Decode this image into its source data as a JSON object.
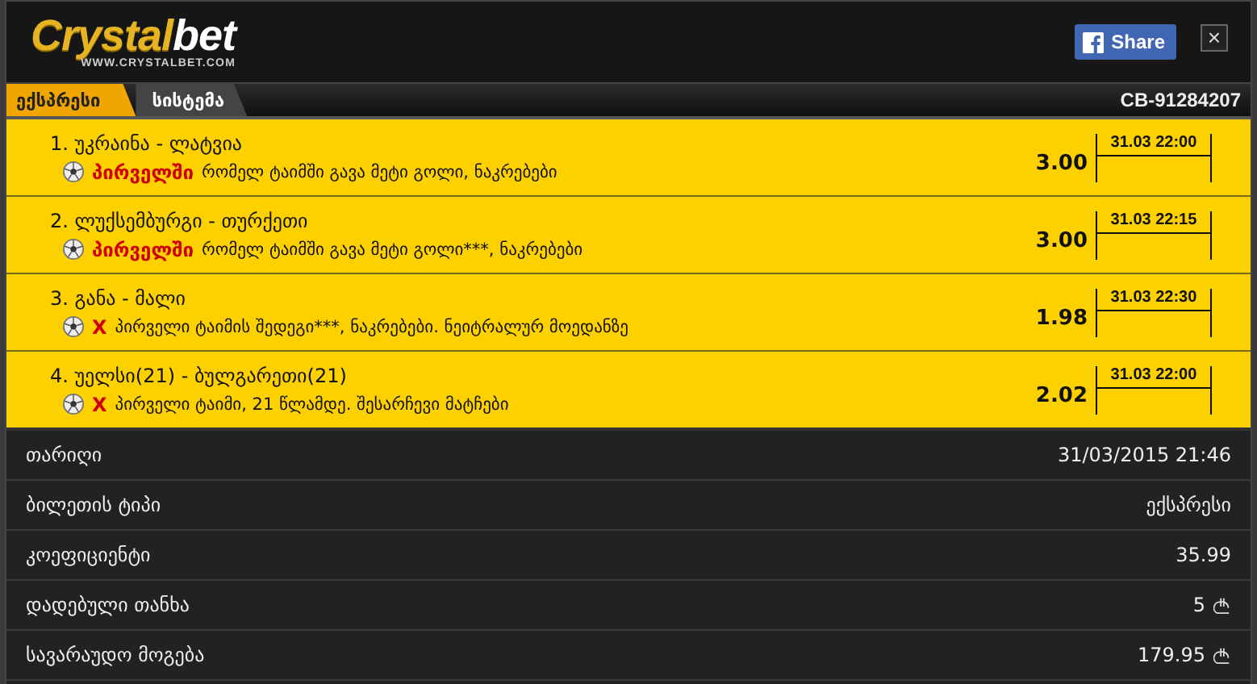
{
  "logo": {
    "part1": "Crystal",
    "part2": "bet",
    "url": "WWW.CRYSTALBET.COM"
  },
  "share_button": {
    "label": "Share"
  },
  "close_button": {
    "label": "×"
  },
  "tabs": [
    {
      "label": "ექსპრესი",
      "selected": true
    },
    {
      "label": "სისტემა",
      "selected": false
    }
  ],
  "ticket_id": "CB-91284207",
  "bets": [
    {
      "match": "1. უკრაინა - ლატვია",
      "pick": "პირველში",
      "market": "რომელ ტაიმში გავა მეტი გოლი, ნაკრებები",
      "odds": "3.00",
      "time": "31.03 22:00"
    },
    {
      "match": "2. ლუქსემბურგი - თურქეთი",
      "pick": "პირველში",
      "market": "რომელ ტაიმში გავა მეტი გოლი***, ნაკრებები",
      "odds": "3.00",
      "time": "31.03 22:15"
    },
    {
      "match": "3. განა - მალი",
      "pick": "X",
      "market": "პირველი ტაიმის შედეგი***, ნაკრებები. ნეიტრალურ მოედანზე",
      "odds": "1.98",
      "time": "31.03 22:30"
    },
    {
      "match": "4. უელსი(21) - ბულგარეთი(21)",
      "pick": "X",
      "market": "პირველი ტაიმი, 21 წლამდე. შესარჩევი მატჩები",
      "odds": "2.02",
      "time": "31.03 22:00"
    }
  ],
  "summary": [
    {
      "label": "თარიღი",
      "value": "31/03/2015 21:46",
      "kind": "text"
    },
    {
      "label": "ბილეთის ტიპი",
      "value": "ექსპრესი",
      "kind": "text"
    },
    {
      "label": "კოეფიციენტი",
      "value": "35.99",
      "kind": "text"
    },
    {
      "label": "დადებული თანხა",
      "value": "5",
      "kind": "money"
    },
    {
      "label": "სავარაუდო მოგება",
      "value": "179.95",
      "kind": "money"
    }
  ]
}
